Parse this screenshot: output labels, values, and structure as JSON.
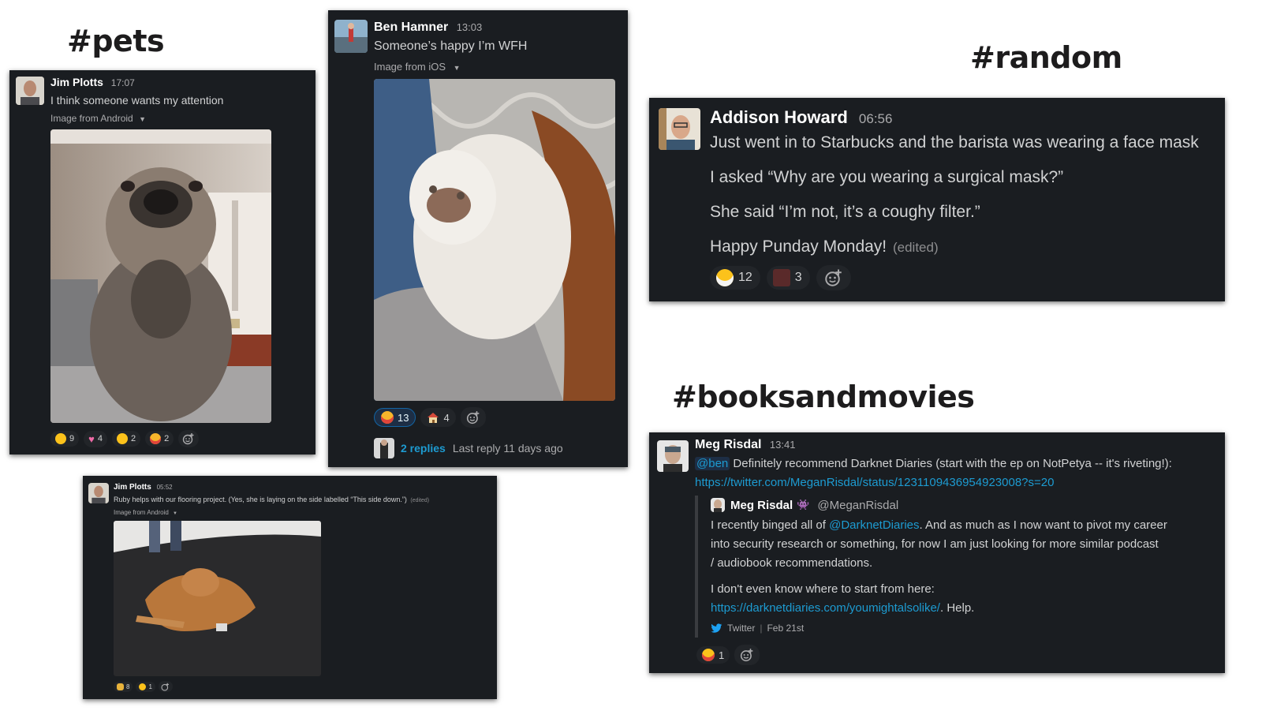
{
  "headings": {
    "pets": "#pets",
    "random": "#random",
    "booksandmovies": "#booksandmovies"
  },
  "pets_jim": {
    "author": "Jim Plotts",
    "time": "17:07",
    "text": "I think someone wants my attention",
    "image_source": "Image from Android",
    "reactions": [
      {
        "icon": "rolling-eyes-emoji",
        "count": "9"
      },
      {
        "icon": "pink-heart-emoji",
        "count": "4"
      },
      {
        "icon": "drooling-face-emoji",
        "count": "2"
      },
      {
        "icon": "heart-eyes-emoji",
        "count": "2"
      }
    ]
  },
  "pets_ben": {
    "author": "Ben Hamner",
    "time": "13:03",
    "text": "Someone’s happy I’m WFH",
    "image_source": "Image from iOS",
    "reactions": [
      {
        "icon": "heart-eyes-emoji",
        "count": "13"
      },
      {
        "icon": "house-emoji",
        "count": "4"
      }
    ],
    "replies": "2 replies",
    "last_reply": "Last reply 11 days ago"
  },
  "pets_jim2": {
    "author": "Jim Plotts",
    "time": "05:52",
    "text": "Ruby helps with our flooring project.  (Yes, she is laying on the side labelled “This side down.”)",
    "edited": "(edited)",
    "image_source": "Image from Android",
    "reactions": [
      {
        "icon": "person-emoji",
        "count": "8"
      },
      {
        "icon": "smile-emoji",
        "count": "1"
      }
    ]
  },
  "random_addison": {
    "author": "Addison Howard",
    "time": "06:56",
    "lines": [
      "Just went in to Starbucks and the barista was wearing a face mask",
      "I asked “Why are you wearing a surgical mask?”",
      "She said “I’m not, it’s a coughy filter.”",
      "Happy Punday Monday!"
    ],
    "edited": "(edited)",
    "reactions": [
      {
        "icon": "face-mask-emoji",
        "count": "12"
      },
      {
        "icon": "custom-emoji",
        "count": "3"
      }
    ]
  },
  "books_meg": {
    "author": "Meg Risdal",
    "time": "13:41",
    "mention": "@ben",
    "text": " Definitely recommend Darknet Diaries (start with the ep on NotPetya -- it's riveting!):",
    "url": "https://twitter.com/MeganRisdal/status/1231109436954923008?s=20",
    "quote": {
      "author": "Meg Risdal",
      "handle": "@MeganRisdal",
      "line1a": "I recently binged all of ",
      "line1_link": "@DarknetDiaries",
      "line1b": ". And as much as I now want to pivot my career",
      "line2": "into security research or something, for now I am just looking for more similar podcast",
      "line3": "/ audiobook recommendations.",
      "line4": "I don't even know where to start from here:",
      "line5_link": "https://darknetdiaries.com/youmightalsolike/",
      "line5b": ". Help.",
      "source": "Twitter",
      "date": "Feb 21st"
    },
    "reactions": [
      {
        "icon": "tongue-out-emoji",
        "count": "1"
      }
    ]
  }
}
